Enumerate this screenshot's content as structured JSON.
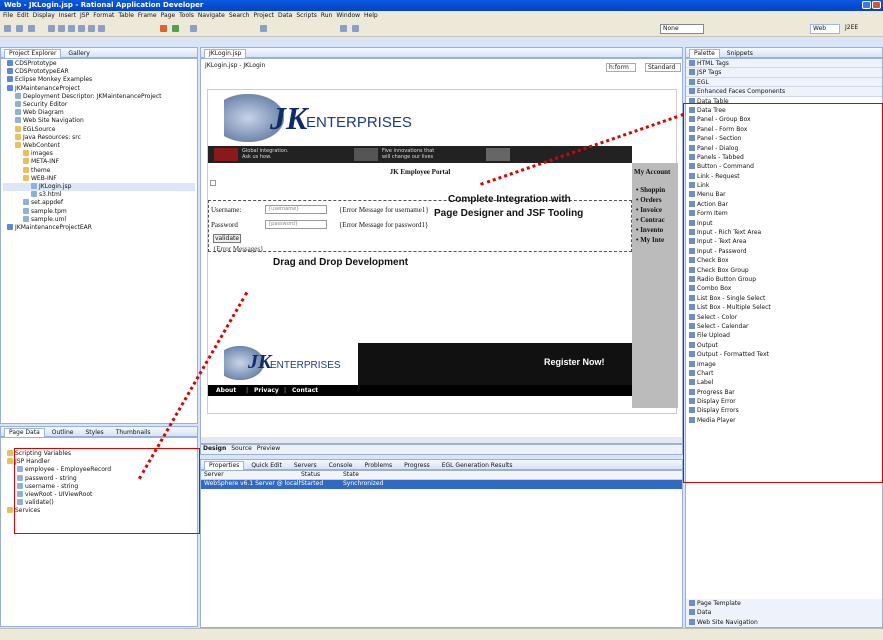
{
  "window": {
    "title": "Web - JKLogin.jsp - Rational Application Developer"
  },
  "menu": [
    "File",
    "Edit",
    "Display",
    "Insert",
    "JSP",
    "Format",
    "Table",
    "Frame",
    "Page",
    "Tools",
    "Navigate",
    "Search",
    "Project",
    "Data",
    "Scripts",
    "Run",
    "Window",
    "Help"
  ],
  "toolbar": {
    "combo_value": "None",
    "perspective_web": "Web",
    "perspective_j2ee": "J2EE"
  },
  "project_explorer": {
    "tabs": [
      "Project Explorer",
      "Gallery"
    ],
    "items": [
      "CDSPrototype",
      "CDSPrototypeEAR",
      "Eclipse Monkey Examples",
      "JKMaintenanceProject",
      "Deployment Descriptor: JKMaintenanceProject",
      "Security Editor",
      "Web Diagram",
      "Web Site Navigation",
      "EGLSource",
      "Java Resources: src",
      "WebContent",
      "images",
      "META-INF",
      "theme",
      "WEB-INF",
      "JKLogin.jsp",
      "s3.html",
      "set.appdef",
      "sample.tpm",
      "sample.uml",
      "JKMaintenanceProjectEAR"
    ]
  },
  "page_data": {
    "tabs": [
      "Page Data",
      "Outline",
      "Styles",
      "Thumbnails"
    ],
    "items": [
      "Scripting Variables",
      "JSP Handler",
      "employee - EmployeeRecord",
      "password - string",
      "username - string",
      "viewRoot - UIViewRoot",
      "validate()",
      "Services"
    ]
  },
  "editor": {
    "tab": "JKLogin.jsp",
    "breadcrumb": "JKLogin.jsp - JKLogin",
    "form_combo": "h:form",
    "mode_combo": "Standard",
    "banner_company": "ENTERPRISES",
    "banner_strip": [
      "Global integration.",
      "Ask us how.",
      "Five innovations that",
      "will change our lives"
    ],
    "portal_title": "JK Employee Portal",
    "username_label": "Username:",
    "username_placeholder": "{username}",
    "username_error": "{Error Message for username1}",
    "password_label": "Password",
    "password_placeholder": "{password}",
    "password_error": "{Error Message for password1}",
    "validate_button": "validate",
    "error_messages": "{Error Messages}",
    "my_account_title": "My Account",
    "my_account_items": [
      "Shoppin",
      "Orders",
      "Invoice",
      "Contrac",
      "Invento",
      "My Inte"
    ],
    "footer_company": "ENTERPRISES",
    "register_button": "Register Now!",
    "footer_links": [
      "About",
      "Privacy",
      "Contact"
    ],
    "view_tabs": [
      "Design",
      "Source",
      "Preview"
    ]
  },
  "callouts": {
    "integration_line1": "Complete Integration with",
    "integration_line2": "Page Designer and JSF Tooling",
    "dnd": "Drag and Drop Development"
  },
  "servers_panel": {
    "tabs": [
      "Properties",
      "Quick Edit",
      "Servers",
      "Console",
      "Problems",
      "Progress",
      "EGL Generation Results"
    ],
    "headers": [
      "Server",
      "Status",
      "State"
    ],
    "row": {
      "server": "WebSphere v6.1 Server @ localhost",
      "status": "Started",
      "state": "Synchronized"
    }
  },
  "palette": {
    "tabs": [
      "Palette",
      "Snippets"
    ],
    "drawers": [
      "HTML Tags",
      "JSP Tags",
      "EGL",
      "Enhanced Faces Components"
    ],
    "items": [
      "Data Table",
      "Data Tree",
      "Panel - Group Box",
      "Panel - Form Box",
      "Panel - Section",
      "Panel - Dialog",
      "Panels - Tabbed",
      "Button - Command",
      "Link - Request",
      "Link",
      "Menu Bar",
      "Action Bar",
      "Form Item",
      "Input",
      "Input - Rich Text Area",
      "Input - Text Area",
      "Input - Password",
      "Check Box",
      "Check Box Group",
      "Radio Button Group",
      "Combo Box",
      "List Box - Single Select",
      "List Box - Multiple Select",
      "Select - Color",
      "Select - Calendar",
      "File Upload",
      "Output",
      "Output - Formatted Text",
      "Image",
      "Chart",
      "Label",
      "Progress Bar",
      "Display Error",
      "Display Errors",
      "Media Player"
    ],
    "bottom_drawers": [
      "Page Template",
      "Data",
      "Web Site Navigation"
    ]
  },
  "colors": {
    "annotation_red": "#e00000",
    "title_blue": "#0a5adf",
    "selection_blue": "#316ac5"
  }
}
